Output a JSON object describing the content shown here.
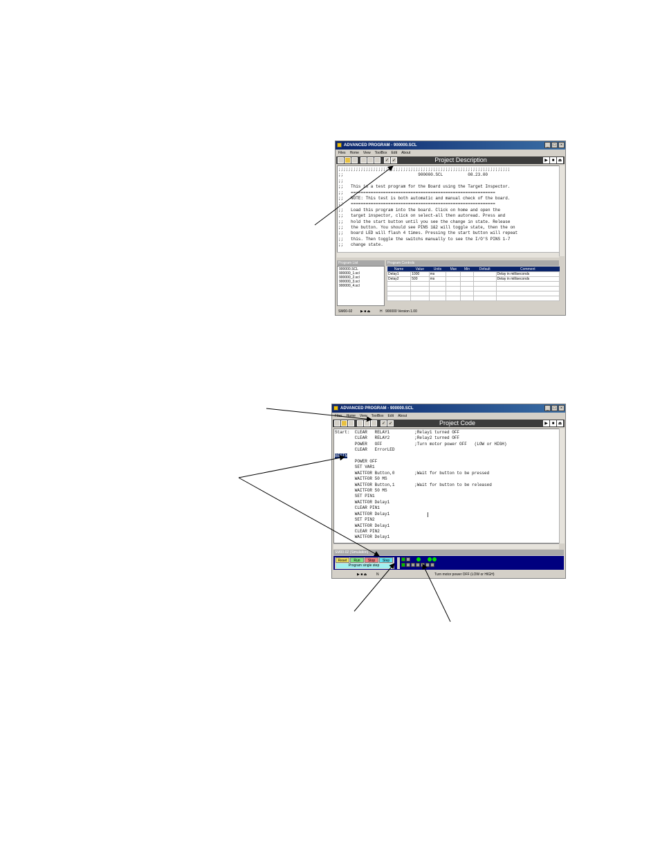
{
  "colors": {
    "titlebar": "#0a246a",
    "toolbar": "#3c3c3c",
    "sim_panel": "#00007f",
    "led": "#00e000"
  },
  "window1": {
    "title": "ADVANCED PROGRAM - 900000.SCL",
    "menu": [
      "Files",
      "Home",
      "View",
      "ToolBox",
      "Edit",
      "About"
    ],
    "toolbar_title": "Project Description",
    "code": ";;;;;;;;;;;;;;;;;;;;;;;;;;;;;;;;;;;;;;;;;;;;;;;;;;;;;;;;;;;;;;;;;;;;;\n;;                              900000.SCL          08.23.00\n;;\n;;   This is a test program for the Board using the Target Inspector.\n;;   ==========================================================\n;;   NOTE: This test is both automatic and manual check of the board.\n;;   ==========================================================\n;;   Load this program into the board. Click on home and open the\n;;   target inspector, click on select-all then autoread. Press and\n;;   hold the start button until you see the change in state. Release\n;;   the button. You should see PINS 1&2 will toggle state, then the on\n;;   board LED will flash 4 times. Pressing the start button will repeat\n;;   this. Then toggle the switchs manually to see the I/O'S PINS 1-7\n;;   change state.",
    "program_list_header": "Program List",
    "program_list": [
      "900000.SCL",
      "900000_1.scl",
      "900000_2.scl",
      "900000_3.scl",
      "900000_4.scl"
    ],
    "program_controls_header": "Program Controls",
    "controls_columns": [
      "Name",
      "Value",
      "Units",
      "Max",
      "Min",
      "Default",
      "Comment"
    ],
    "controls_rows": [
      [
        "Delay1",
        "1000",
        "ms",
        "",
        "",
        "",
        "Delay in milliseconds"
      ],
      [
        "Delay2",
        "500",
        "ms",
        "",
        "",
        "",
        "Delay in milliseconds"
      ]
    ],
    "status_left": "SM00-02",
    "status_mid": "H",
    "status_right": "900000 Version 1.00"
  },
  "window2": {
    "title": "ADVANCED PROGRAM - 900000.SCL",
    "menu": [
      "Files",
      "Home",
      "View",
      "ToolBox",
      "Edit",
      "About"
    ],
    "toolbar_title": "Project Code",
    "code_before": "Start:  CLEAR   RELAY1          ;Relay1 turned OFF\n        CLEAR   RELAY2          ;Relay2 turned OFF\n        POWER   OFF             ;Turn motor power OFF   (LOW or HIGH)\n        CLEAR   ErrorLED\n",
    "code_begin": "BEGIN",
    "code_after": "\n        POWER OFF\n        SET VAR1\n        WAITFOR Button,0        ;Wait for button to be pressed\n        WAITFOR 50 MS\n        WAITFOR Button,1        ;Wait for button to be released\n        WAITFOR 50 MS\n        SET PIN1\n        WAITFOR Delay1\n        CLEAR PIN1\n        WAITFOR Delay1\n        SET PIN2\n        WAITFOR Delay1\n        CLEAR PIN2\n        WAITFOR Delay1",
    "sim_header": "SM00-02 (Simulation)",
    "sim_buttons": [
      "Reset",
      "Run",
      "Stop",
      "Step"
    ],
    "sim_tooltip": "Program single step",
    "status_mid": "N",
    "status_right": "Turn motor power OFF   (LOW or HIGH)"
  }
}
